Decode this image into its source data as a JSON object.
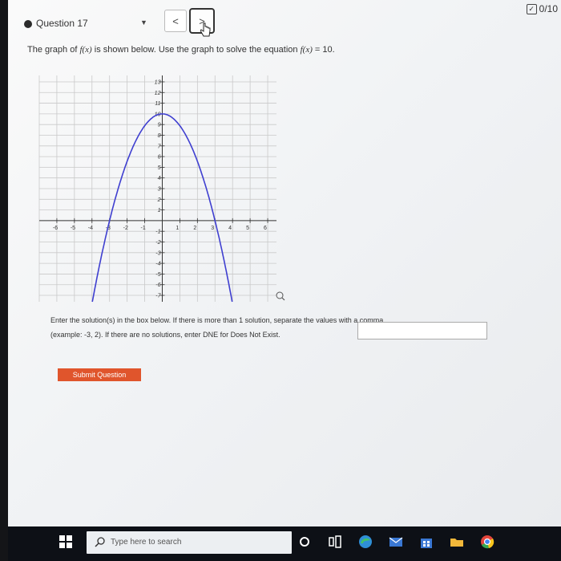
{
  "header": {
    "question_label": "Question 17",
    "prev_glyph": "<",
    "next_glyph": ">",
    "score": "0/10",
    "score_icon": "checkbox-icon"
  },
  "prompt": {
    "pre": "The graph of ",
    "fx": "f(x)",
    "mid": " is shown below. Use the graph to solve the equation ",
    "fx2": "f(x)",
    "post": " = 10."
  },
  "graph": {
    "x_ticks": [
      "-6",
      "-5",
      "-4",
      "-3",
      "-2",
      "-1",
      "1",
      "2",
      "3",
      "4",
      "5",
      "6"
    ],
    "y_ticks": [
      "13",
      "12",
      "11",
      "10",
      "9",
      "8",
      "7",
      "6",
      "5",
      "4",
      "3",
      "2",
      "1",
      "-1",
      "-2",
      "-3",
      "-4",
      "-5",
      "-6",
      "-7"
    ],
    "x_range": [
      -6,
      6
    ],
    "y_range": [
      -7,
      13
    ],
    "curve": {
      "type": "parabola",
      "vertex": [
        0,
        10
      ],
      "x_intercepts": [
        -3,
        3
      ],
      "a": -1.111
    },
    "curve_color": "#3f3fd0",
    "zoom_icon": "magnifier-icon"
  },
  "instructions": {
    "line1": "Enter the solution(s) in the box below. If there is more than 1 solution, separate the values with a comma",
    "line2": "(example: -3, 2). If there are no solutions, enter DNE for Does Not Exist."
  },
  "answer": {
    "value": "",
    "placeholder": ""
  },
  "submit": {
    "label": "Submit Question",
    "color": "#e0552c"
  },
  "taskbar": {
    "search_placeholder": "Type here to search",
    "icons": [
      "windows-icon",
      "search-icon",
      "cortana-icon",
      "task-view-icon",
      "edge-icon",
      "mail-icon",
      "store-icon",
      "folder-icon",
      "chrome-icon"
    ]
  }
}
